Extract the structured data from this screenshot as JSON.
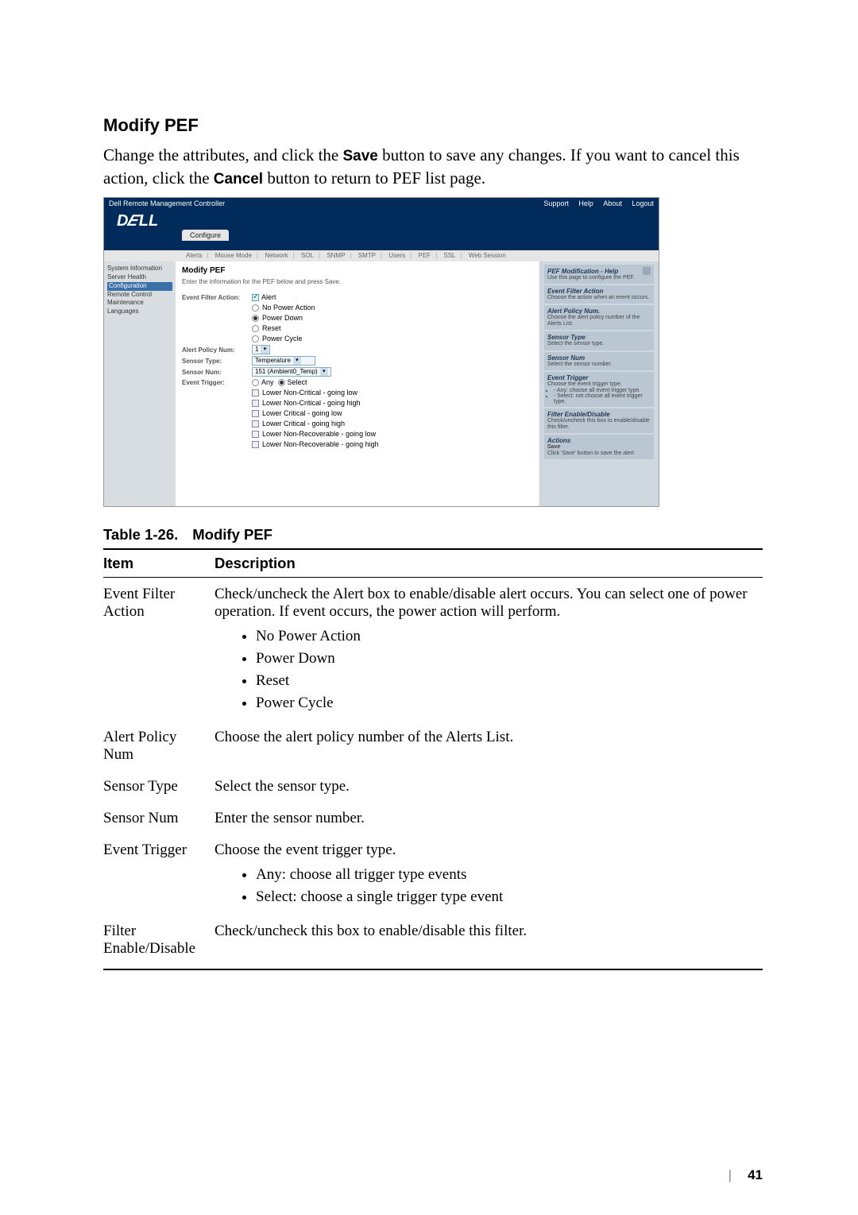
{
  "heading": "Modify PEF",
  "intro_pre": "Change the attributes, and click the ",
  "intro_b1": "Save",
  "intro_mid": " button to save any changes. If you want to cancel this action, click the ",
  "intro_b2": "Cancel",
  "intro_post": " button to return to PEF list page.",
  "shot": {
    "title_bar": "Dell Remote Management Controller",
    "top_links": [
      "Support",
      "Help",
      "About",
      "Logout"
    ],
    "brand": "DELL",
    "active_tab": "Configure",
    "subtabs": [
      "Alerts",
      "Mouse Mode",
      "Network",
      "SOL",
      "SNMP",
      "SMTP",
      "Users",
      "PEF",
      "SSL",
      "Web Session"
    ],
    "nav": [
      "System Information",
      "Server Health",
      "Configuration",
      "Remote Control",
      "Maintenance",
      "Languages"
    ],
    "form": {
      "title": "Modify PEF",
      "subtitle": "Enter the information for the PEF below and press Save.",
      "rows": {
        "efa_label": "Event Filter Action:",
        "efa_alert": "Alert",
        "efa_opts": [
          "No Power Action",
          "Power Down",
          "Reset",
          "Power Cycle"
        ],
        "apn_label": "Alert Policy Num:",
        "apn_value": "1",
        "st_label": "Sensor Type:",
        "st_value": "Temperature",
        "sn_label": "Sensor Num:",
        "sn_value": "151 (Ambient0_Temp)",
        "et_label": "Event Trigger:",
        "et_any": "Any",
        "et_select": "Select",
        "et_opts": [
          "Lower Non-Critical - going low",
          "Lower Non-Critical - going high",
          "Lower Critical - going low",
          "Lower Critical - going high",
          "Lower Non-Recoverable - going low",
          "Lower Non-Recoverable - going high"
        ]
      }
    },
    "help": {
      "header": "PEF Modification - Help",
      "header_sub": "Use this page to configure the PEF.",
      "s1_t": "Event Filter Action",
      "s1_b": "Choose the action when an event occurs.",
      "s2_t": "Alert Policy Num.",
      "s2_b": "Choose the alert policy number of the Alerts List.",
      "s3_t": "Sensor Type",
      "s3_b": "Select the sensor type.",
      "s4_t": "Sensor Num",
      "s4_b": "Select the sensor number.",
      "s5_t": "Event Trigger",
      "s5_b": "Choose the event trigger type.",
      "s5_li1": "- Any: choose all event trigger type.",
      "s5_li2": "- Select: not choose all event trigger type.",
      "s6_t": "Filter Enable/Disable",
      "s6_b": "Check/uncheck this box to enable/disable this filter.",
      "s7_t": "Actions",
      "s7_s": "Save",
      "s7_b": "Click 'Save' button to save the alert"
    }
  },
  "table_caption_lead": "Table 1-26.",
  "table_caption_title": "Modify PEF",
  "thead": {
    "c1": "Item",
    "c2": "Description"
  },
  "rows": {
    "r1_item": "Event Filter Action",
    "r1_desc": "Check/uncheck the Alert box to enable/disable alert occurs. You can select one of power operation. If event occurs, the power action will perform.",
    "r1_b": [
      "No Power Action",
      "Power Down",
      "Reset",
      "Power Cycle"
    ],
    "r2_item": "Alert Policy Num",
    "r2_desc": "Choose the alert policy number of the Alerts List.",
    "r3_item": "Sensor Type",
    "r3_desc": "Select the sensor type.",
    "r4_item": "Sensor Num",
    "r4_desc": "Enter the sensor number.",
    "r5_item": "Event Trigger",
    "r5_desc": "Choose the event trigger type.",
    "r5_b": [
      "Any: choose all trigger type events",
      "Select: choose a single trigger type event"
    ],
    "r6_item": "Filter Enable/Disable",
    "r6_desc": "Check/uncheck this box to enable/disable this filter."
  },
  "page_number": "41"
}
